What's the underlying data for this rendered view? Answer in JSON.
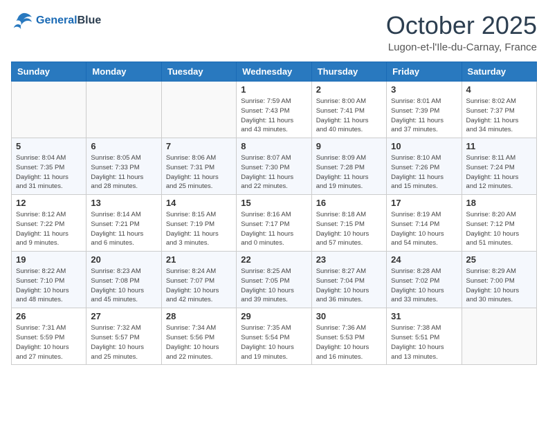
{
  "header": {
    "logo_line1": "General",
    "logo_line2": "Blue",
    "month_title": "October 2025",
    "location": "Lugon-et-l'Ile-du-Carnay, France"
  },
  "weekdays": [
    "Sunday",
    "Monday",
    "Tuesday",
    "Wednesday",
    "Thursday",
    "Friday",
    "Saturday"
  ],
  "rows": [
    [
      {
        "day": "",
        "info": ""
      },
      {
        "day": "",
        "info": ""
      },
      {
        "day": "",
        "info": ""
      },
      {
        "day": "1",
        "info": "Sunrise: 7:59 AM\nSunset: 7:43 PM\nDaylight: 11 hours\nand 43 minutes."
      },
      {
        "day": "2",
        "info": "Sunrise: 8:00 AM\nSunset: 7:41 PM\nDaylight: 11 hours\nand 40 minutes."
      },
      {
        "day": "3",
        "info": "Sunrise: 8:01 AM\nSunset: 7:39 PM\nDaylight: 11 hours\nand 37 minutes."
      },
      {
        "day": "4",
        "info": "Sunrise: 8:02 AM\nSunset: 7:37 PM\nDaylight: 11 hours\nand 34 minutes."
      }
    ],
    [
      {
        "day": "5",
        "info": "Sunrise: 8:04 AM\nSunset: 7:35 PM\nDaylight: 11 hours\nand 31 minutes."
      },
      {
        "day": "6",
        "info": "Sunrise: 8:05 AM\nSunset: 7:33 PM\nDaylight: 11 hours\nand 28 minutes."
      },
      {
        "day": "7",
        "info": "Sunrise: 8:06 AM\nSunset: 7:31 PM\nDaylight: 11 hours\nand 25 minutes."
      },
      {
        "day": "8",
        "info": "Sunrise: 8:07 AM\nSunset: 7:30 PM\nDaylight: 11 hours\nand 22 minutes."
      },
      {
        "day": "9",
        "info": "Sunrise: 8:09 AM\nSunset: 7:28 PM\nDaylight: 11 hours\nand 19 minutes."
      },
      {
        "day": "10",
        "info": "Sunrise: 8:10 AM\nSunset: 7:26 PM\nDaylight: 11 hours\nand 15 minutes."
      },
      {
        "day": "11",
        "info": "Sunrise: 8:11 AM\nSunset: 7:24 PM\nDaylight: 11 hours\nand 12 minutes."
      }
    ],
    [
      {
        "day": "12",
        "info": "Sunrise: 8:12 AM\nSunset: 7:22 PM\nDaylight: 11 hours\nand 9 minutes."
      },
      {
        "day": "13",
        "info": "Sunrise: 8:14 AM\nSunset: 7:21 PM\nDaylight: 11 hours\nand 6 minutes."
      },
      {
        "day": "14",
        "info": "Sunrise: 8:15 AM\nSunset: 7:19 PM\nDaylight: 11 hours\nand 3 minutes."
      },
      {
        "day": "15",
        "info": "Sunrise: 8:16 AM\nSunset: 7:17 PM\nDaylight: 11 hours\nand 0 minutes."
      },
      {
        "day": "16",
        "info": "Sunrise: 8:18 AM\nSunset: 7:15 PM\nDaylight: 10 hours\nand 57 minutes."
      },
      {
        "day": "17",
        "info": "Sunrise: 8:19 AM\nSunset: 7:14 PM\nDaylight: 10 hours\nand 54 minutes."
      },
      {
        "day": "18",
        "info": "Sunrise: 8:20 AM\nSunset: 7:12 PM\nDaylight: 10 hours\nand 51 minutes."
      }
    ],
    [
      {
        "day": "19",
        "info": "Sunrise: 8:22 AM\nSunset: 7:10 PM\nDaylight: 10 hours\nand 48 minutes."
      },
      {
        "day": "20",
        "info": "Sunrise: 8:23 AM\nSunset: 7:08 PM\nDaylight: 10 hours\nand 45 minutes."
      },
      {
        "day": "21",
        "info": "Sunrise: 8:24 AM\nSunset: 7:07 PM\nDaylight: 10 hours\nand 42 minutes."
      },
      {
        "day": "22",
        "info": "Sunrise: 8:25 AM\nSunset: 7:05 PM\nDaylight: 10 hours\nand 39 minutes."
      },
      {
        "day": "23",
        "info": "Sunrise: 8:27 AM\nSunset: 7:04 PM\nDaylight: 10 hours\nand 36 minutes."
      },
      {
        "day": "24",
        "info": "Sunrise: 8:28 AM\nSunset: 7:02 PM\nDaylight: 10 hours\nand 33 minutes."
      },
      {
        "day": "25",
        "info": "Sunrise: 8:29 AM\nSunset: 7:00 PM\nDaylight: 10 hours\nand 30 minutes."
      }
    ],
    [
      {
        "day": "26",
        "info": "Sunrise: 7:31 AM\nSunset: 5:59 PM\nDaylight: 10 hours\nand 27 minutes."
      },
      {
        "day": "27",
        "info": "Sunrise: 7:32 AM\nSunset: 5:57 PM\nDaylight: 10 hours\nand 25 minutes."
      },
      {
        "day": "28",
        "info": "Sunrise: 7:34 AM\nSunset: 5:56 PM\nDaylight: 10 hours\nand 22 minutes."
      },
      {
        "day": "29",
        "info": "Sunrise: 7:35 AM\nSunset: 5:54 PM\nDaylight: 10 hours\nand 19 minutes."
      },
      {
        "day": "30",
        "info": "Sunrise: 7:36 AM\nSunset: 5:53 PM\nDaylight: 10 hours\nand 16 minutes."
      },
      {
        "day": "31",
        "info": "Sunrise: 7:38 AM\nSunset: 5:51 PM\nDaylight: 10 hours\nand 13 minutes."
      },
      {
        "day": "",
        "info": ""
      }
    ]
  ]
}
